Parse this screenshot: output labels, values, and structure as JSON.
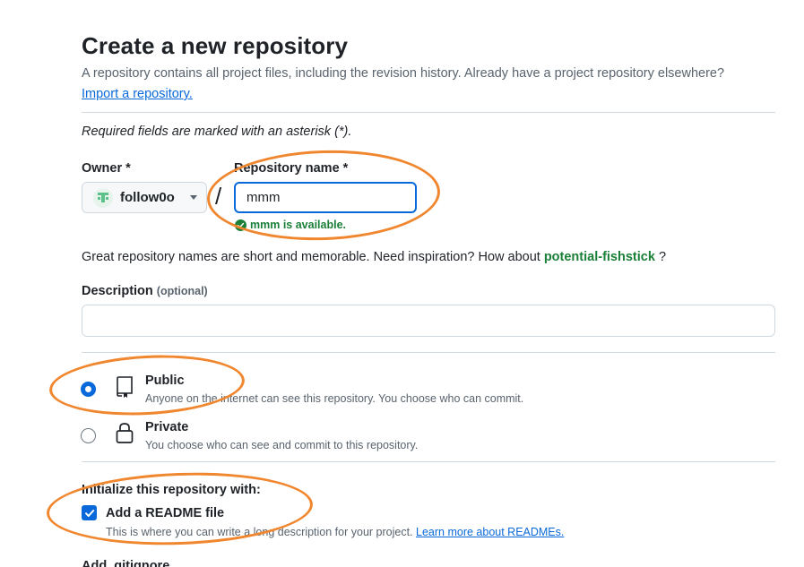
{
  "header": {
    "title": "Create a new repository",
    "subtitle": "A repository contains all project files, including the revision history. Already have a project repository elsewhere?",
    "import_link": "Import a repository."
  },
  "form": {
    "required_note": "Required fields are marked with an asterisk (*).",
    "owner": {
      "label": "Owner *",
      "value": "follow0o",
      "avatar_icon": "identicon-icon"
    },
    "separator": "/",
    "repo_name": {
      "label": "Repository name *",
      "value": "mmm",
      "availability": "mmm is available."
    },
    "inspiration": {
      "prefix": "Great repository names are short and memorable. Need inspiration? How about",
      "suggestion": "potential-fishstick",
      "suffix": "?"
    },
    "description": {
      "label": "Description",
      "optional": "(optional)",
      "value": ""
    },
    "visibility": {
      "options": [
        {
          "title": "Public",
          "desc": "Anyone on the internet can see this repository. You choose who can commit.",
          "icon": "repo-icon",
          "selected": true
        },
        {
          "title": "Private",
          "desc": "You choose who can see and commit to this repository.",
          "icon": "lock-icon",
          "selected": false
        }
      ]
    },
    "initialize": {
      "label": "Initialize this repository with:",
      "readme": {
        "label": "Add a README file",
        "checked": true,
        "desc": "This is where you can write a long description for your project.",
        "link": "Learn more about READMEs."
      },
      "gitignore_label": "Add .gitignore"
    }
  },
  "colors": {
    "accent": "#0969da",
    "success": "#1a7f37",
    "annotation": "#f0862e",
    "muted": "#59636e"
  }
}
